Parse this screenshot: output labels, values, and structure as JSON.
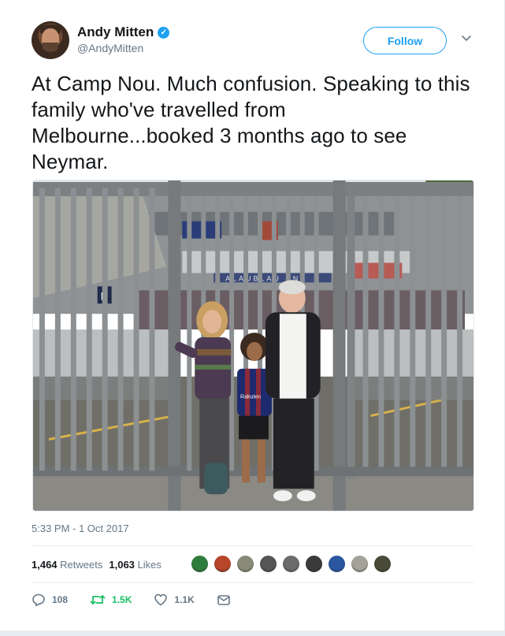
{
  "author": {
    "name": "Andy Mitten",
    "handle": "@AndyMitten",
    "verified_mark": "✓"
  },
  "follow_label": "Follow",
  "tweet": {
    "text": "At Camp Nou. Much confusion. Speaking to this family who've travelled from Melbourne...booked 3 months ago to see Neymar."
  },
  "photo": {
    "sign_text": "ALAUBLAU RN",
    "parking_sign": "P",
    "shirt_text": "Rakuten"
  },
  "timestamp": "5:33 PM - 1 Oct 2017",
  "stats": {
    "retweets_count": "1,464",
    "retweets_label": "Retweets",
    "likes_count": "1,063",
    "likes_label": "Likes"
  },
  "liker_avatars": [
    "#2f7d3c",
    "#b6452a",
    "#8a8a7a",
    "#555555",
    "#6b6b6b",
    "#3a3a3a",
    "#2a57a0",
    "#a3a39a",
    "#4a4a3a"
  ],
  "actions": {
    "reply_count": "108",
    "retweet_count": "1.5K",
    "like_count": "1.1K"
  },
  "colors": {
    "accent": "#1da1f2",
    "retweet": "#17bf63",
    "muted": "#657786"
  },
  "icons": [
    "verified-badge-icon",
    "chevron-down-icon",
    "reply-icon",
    "retweet-icon",
    "heart-icon",
    "message-icon"
  ]
}
